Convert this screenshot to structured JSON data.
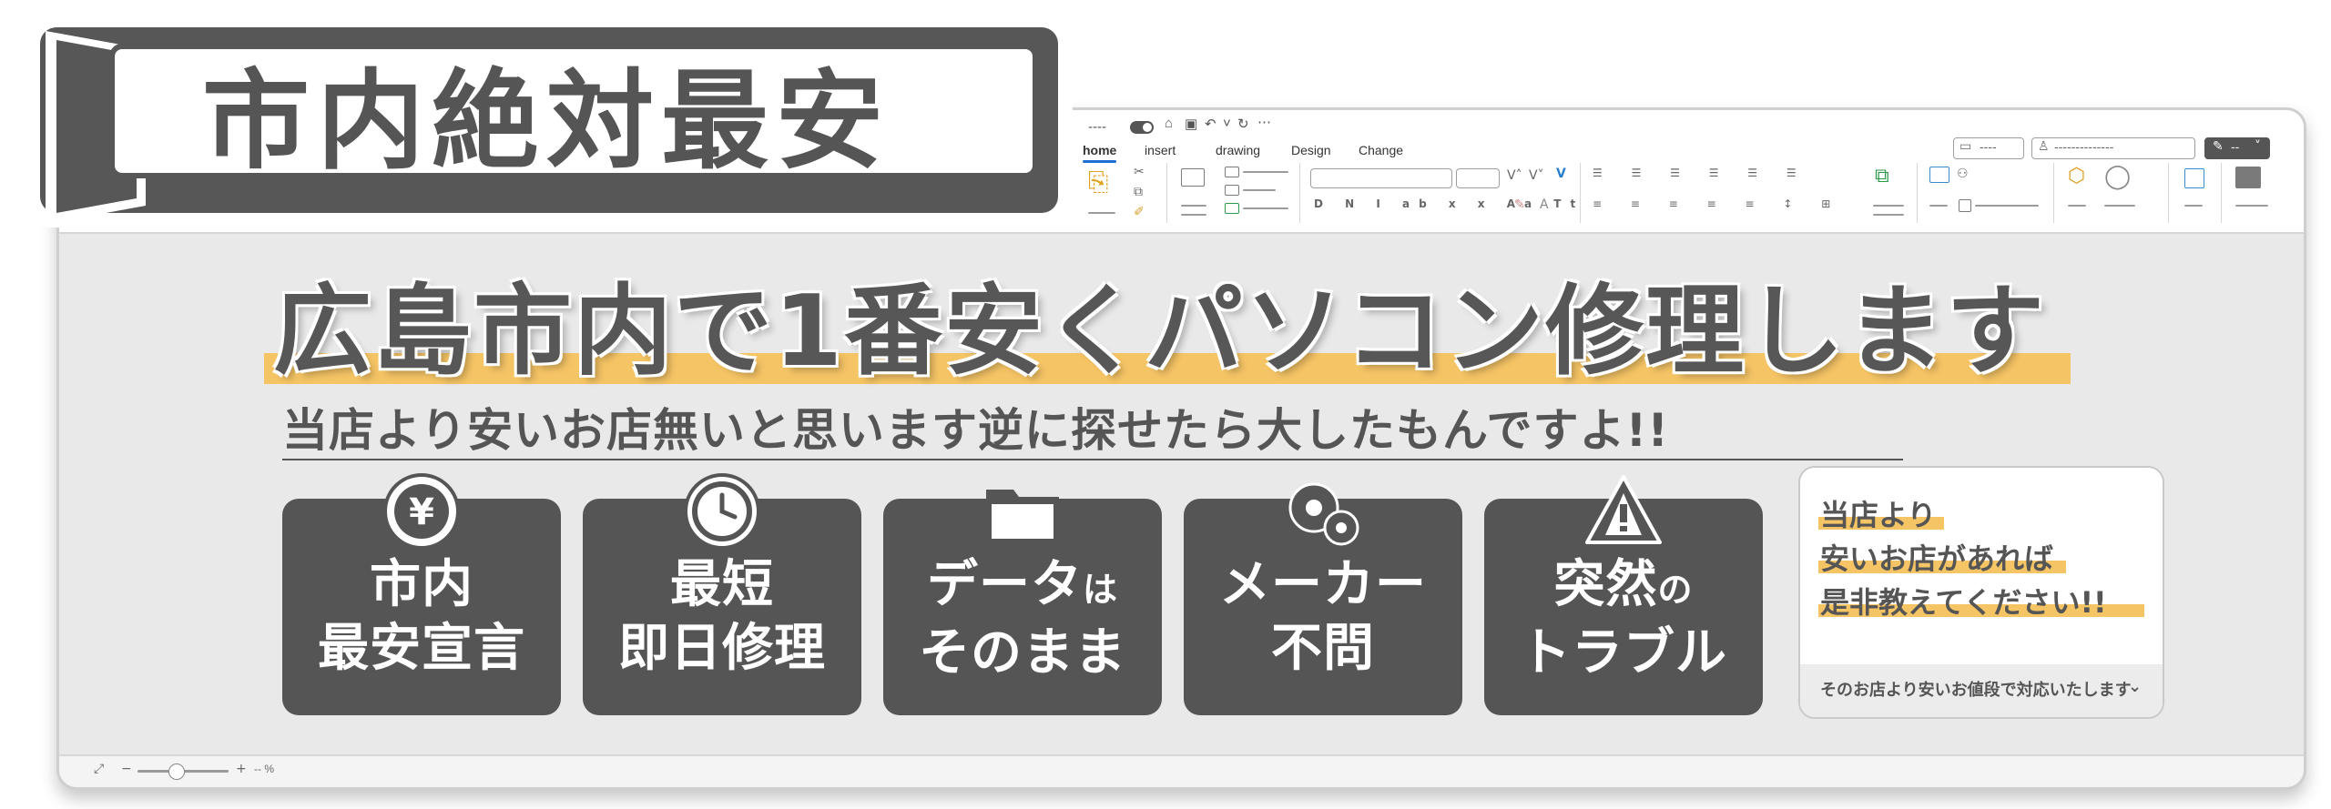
{
  "title_tab": {
    "text": "市内絶対最安"
  },
  "ribbon": {
    "tabs": [
      {
        "label": "home",
        "active": true
      },
      {
        "label": "insert",
        "active": false
      },
      {
        "label": "drawing",
        "active": false
      },
      {
        "label": "Design",
        "active": false
      },
      {
        "label": "Change",
        "active": false
      }
    ],
    "comment_button": "----",
    "share_field": "--------------",
    "editing_button": "--",
    "font_size_grow": "V˄",
    "font_size_shrink": "V˅",
    "format_glyph": "V"
  },
  "headline": "広島市内で1番安くパソコン修理します",
  "subline": "当店より安いお店無いと思います逆に探せたら大したもんですよ!!",
  "cards": [
    {
      "line1": "市内",
      "line2": "最安宣言",
      "icon": "yen-coin-icon"
    },
    {
      "line1": "最短",
      "line2": "即日修理",
      "icon": "clock-icon"
    },
    {
      "line1": "データ",
      "line1_small": "は",
      "line2": "そのまま",
      "icon": "folder-icon"
    },
    {
      "line1": "メーカー",
      "line2": "不問",
      "icon": "gears-icon"
    },
    {
      "line1": "突然",
      "line1_small": "の",
      "line2": "トラブル",
      "icon": "warning-icon"
    }
  ],
  "panel": {
    "lines": [
      "当店より",
      "安いお店があれば",
      "是非教えてください!!"
    ],
    "footer": "そのお店より安いお値段で対応いたします"
  },
  "statusbar": {
    "zoom_value": "-- %"
  },
  "colors": {
    "primary": "#565555",
    "accent": "#f5c465",
    "window_bg": "#e9e9e9",
    "ribbon_accent": "#1d6fd6"
  }
}
